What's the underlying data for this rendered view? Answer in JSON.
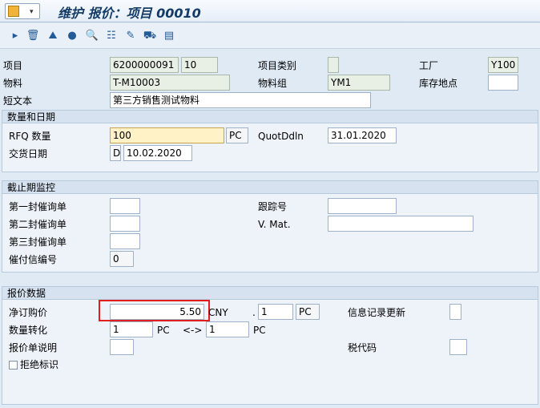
{
  "header": {
    "title": "维护 报价：项目 00010",
    "menu_arrow": "▾"
  },
  "toolbar": {
    "icons": [
      "arrow-icon",
      "delete-icon",
      "landscape-icon",
      "disk-icon",
      "magnifier-icon",
      "tree-icon",
      "edit-icon",
      "truck-icon",
      "list-icon"
    ]
  },
  "top": {
    "item_label": "项目",
    "item_doc": "6200000091",
    "item_no": "10",
    "item_cat_label": "项目类别",
    "item_cat": "",
    "plant_label": "工厂",
    "plant": "Y100",
    "material_label": "物料",
    "material": "T-M10003",
    "matgroup_label": "物料组",
    "matgroup": "YM1",
    "storage_label": "库存地点",
    "storage": "",
    "short_text_label": "短文本",
    "short_text": "第三方销售测试物料"
  },
  "qty": {
    "title": "数量和日期",
    "rfq_label": "RFQ 数量",
    "rfq_value": "100",
    "rfq_unit": "PC",
    "quotddln_label": "QuotDdln",
    "quotddln": "31.01.2020",
    "delivery_label": "交货日期",
    "delivery_type": "D",
    "delivery_date": "10.02.2020"
  },
  "deadline": {
    "title": "截止期监控",
    "r1_label": "第一封催询单",
    "r1": "",
    "tracking_label": "跟踪号",
    "tracking": "",
    "r2_label": "第二封催询单",
    "r2": "",
    "vmat_label": "V. Mat.",
    "vmat": "",
    "r3_label": "第三封催询单",
    "r3": "",
    "dun_label": "催付信编号",
    "dun": "0"
  },
  "quote": {
    "title": "报价数据",
    "net_label": "净订购价",
    "net_value": "5.50",
    "currency": "CNY",
    "dot": ".",
    "per": "1",
    "per_unit": "PC",
    "info_label": "信息记录更新",
    "info": "",
    "conv_label": "数量转化",
    "conv_from": "1",
    "conv_from_unit": "PC",
    "conv_arrow": "<->",
    "conv_to": "1",
    "conv_to_unit": "PC",
    "desc_label": "报价单说明",
    "desc": "",
    "tax_label": "税代码",
    "tax": "",
    "reject_label": "拒绝标识"
  }
}
